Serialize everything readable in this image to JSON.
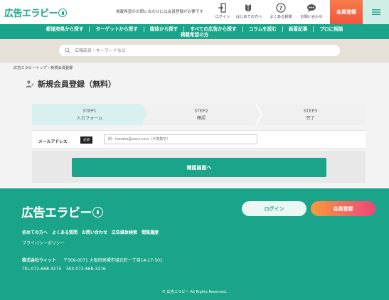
{
  "header": {
    "logo_text": "広告エラビー",
    "notice": "掲載希望のお問い合わせには会員登録が必要です",
    "icons": [
      {
        "label": "ログイン",
        "icon": "login-door-icon"
      },
      {
        "label": "はじめての方へ",
        "icon": "beginner-mark-icon"
      },
      {
        "label": "よくある質問",
        "icon": "question-icon"
      },
      {
        "label": "お問い合わせ",
        "icon": "chat-bubble-icon"
      }
    ],
    "register_label": "会員登録",
    "menu_icon": "hamburger-menu-icon"
  },
  "nav": {
    "items": [
      "都道府県から探す",
      "ターゲットから探す",
      "媒体から探す",
      "すべての広告から探す",
      "コラムを読む",
      "新着記事",
      "プロに相談",
      "掲載希望の方"
    ]
  },
  "search": {
    "placeholder": "広報誌名・キーワードなど",
    "icon": "search-icon"
  },
  "breadcrumb": {
    "home": "広告エラビートップ",
    "separator": "›",
    "current": "新規会員登録"
  },
  "page": {
    "title": "新規会員登録（無料）",
    "title_icon": "user-edit-icon"
  },
  "steps": [
    {
      "num": "STEP1",
      "label": "入力フォーム",
      "active": true
    },
    {
      "num": "STEP2",
      "label": "確認",
      "active": false
    },
    {
      "num": "STEP3",
      "label": "完了",
      "active": false
    }
  ],
  "form": {
    "email_label": "メールアドレス",
    "required_badge": "必須",
    "email_placeholder": "例：hanako@xxxx.com（半角数字）",
    "email_value": ""
  },
  "confirm_button": "確認画面へ",
  "footer": {
    "logo_text": "広告エラビー",
    "login_label": "ログイン",
    "register_label": "会員登録",
    "links": [
      "初めての方へ",
      "よくある質問",
      "お問い合わせ",
      "広告媒体検索",
      "閲覧履歴"
    ],
    "privacy": "プライバシーポリシー",
    "company_name": "株式会社ウィット",
    "address": "〒569-0071 大阪府高槻市城北町一丁目14-17-501",
    "tel": "TEL.072-668-3275",
    "fax": "FAX.072-668-3276",
    "copyright": "© 広告エラビー All Rights Reserved."
  },
  "colors": {
    "brand_green": "#1aa58a",
    "register_orange": "#f2553c",
    "step_active": "#d8f1f0",
    "search_band": "#e5e0d8"
  }
}
